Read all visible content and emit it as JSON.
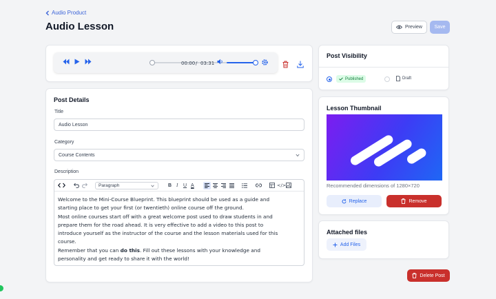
{
  "breadcrumb": {
    "back_label": "Audio Product"
  },
  "page": {
    "title": "Audio Lesson"
  },
  "header": {
    "preview_label": "Preview",
    "save_label": "Save"
  },
  "player": {
    "current_time": "00:00",
    "separator": "/",
    "duration": "03:31",
    "progress": 0.0,
    "volume": 1.0
  },
  "post_details": {
    "title": "Post Details",
    "title_label": "Title",
    "title_value": "Audio Lesson",
    "category_label": "Category",
    "category_value": "Course Contents",
    "description_label": "Description",
    "block_format": "Paragraph",
    "body": {
      "line1": "Welcome to the Mini-Course Blueprint. This blueprint should be used as a guide and",
      "line2": "starting place to get your first (or twentieth) online course off the ground.",
      "line3": "Most online courses start off with a great welcome post used to draw students in and",
      "line4": "prepare them for the road ahead. It is very effective to add a video to this post to",
      "line5": "introduce yourself as the instructor of the course and the lesson materials used for this",
      "line6": "course.",
      "line7_a": "Remember that you can ",
      "line7_b": "do this",
      "line7_c": ". Fill out these lessons with your knowledge and",
      "line8": "personality and get ready to share it with the world!"
    }
  },
  "visibility": {
    "title": "Post Visibility",
    "published_label": "Published",
    "draft_label": "Draft",
    "selected": "Published"
  },
  "thumbnail": {
    "title": "Lesson Thumbnail",
    "hint": "Recommended dimensions of 1280×720",
    "replace_label": "Replace",
    "remove_label": "Remove"
  },
  "attachments": {
    "title": "Attached files",
    "add_label": "Add Files"
  },
  "footer": {
    "delete_label": "Delete Post"
  },
  "colors": {
    "accent": "#2563eb",
    "danger": "#c9302c",
    "save_disabled": "#a5b9f0",
    "published_badge_bg": "#dcfce7",
    "published_badge_text": "#15803d"
  }
}
